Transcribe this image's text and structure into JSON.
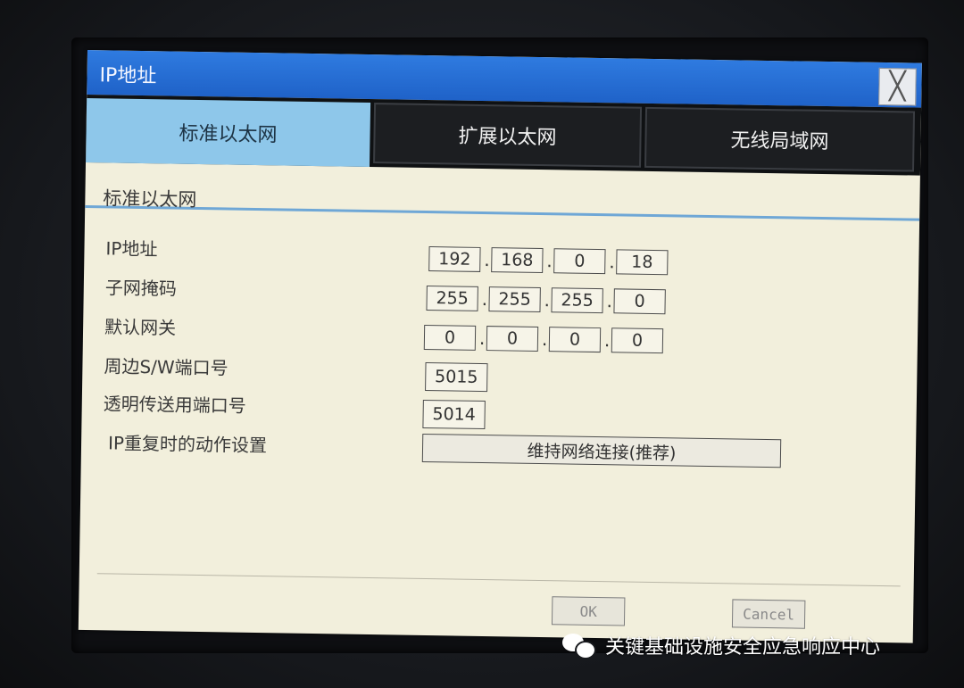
{
  "dialog": {
    "title": "IP地址",
    "close_glyph": "╳"
  },
  "tabs": [
    {
      "label": "标准以太网",
      "active": true
    },
    {
      "label": "扩展以太网",
      "active": false
    },
    {
      "label": "无线局域网",
      "active": false
    }
  ],
  "section_title": "标准以太网",
  "fields": {
    "ip": {
      "label": "IP地址",
      "octets": [
        "192",
        "168",
        "0",
        "18"
      ]
    },
    "subnet": {
      "label": "子网掩码",
      "octets": [
        "255",
        "255",
        "255",
        "0"
      ]
    },
    "gateway": {
      "label": "默认网关",
      "octets": [
        "0",
        "0",
        "0",
        "0"
      ]
    },
    "sw_port": {
      "label": "周边S/W端口号",
      "value": "5015"
    },
    "transparent_port": {
      "label": "透明传送用端口号",
      "value": "5014"
    },
    "ip_conflict": {
      "label": "IP重复时的动作设置",
      "value": "维持网络连接(推荐)"
    }
  },
  "buttons": {
    "ok": "OK",
    "cancel": "Cancel"
  },
  "watermark": {
    "icon": "wechat-icon",
    "text": "关键基础设施安全应急响应中心"
  },
  "colors": {
    "titlebar": "#1f62c8",
    "active_tab": "#8ec7ea",
    "inactive_tab": "#1c1e21",
    "content_bg": "#f2efdc"
  }
}
